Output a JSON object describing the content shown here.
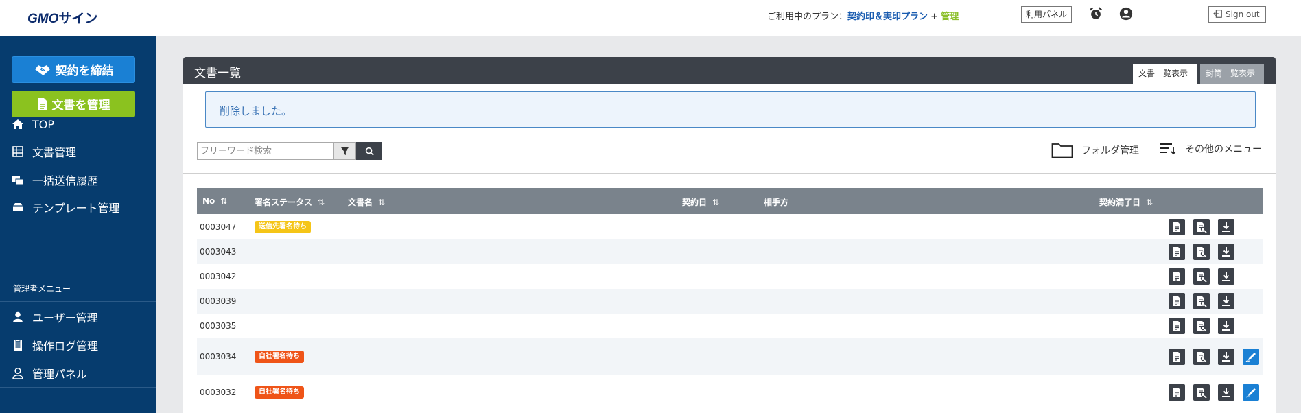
{
  "header": {
    "logo_gmo": "GMO",
    "logo_sign": "サイン",
    "plan_prefix": "ご利用中のプラン：",
    "plan_name": "契約印＆実印プラン",
    "plan_plus": " + ",
    "plan_admin": "管理",
    "panel_button": "利用パネル",
    "signout": "Sign out"
  },
  "sidebar": {
    "contract_button": "契約を締結",
    "docs_button": "文書を管理",
    "items": [
      {
        "label": "TOP",
        "icon": "home-icon"
      },
      {
        "label": "文書管理",
        "icon": "table-icon"
      },
      {
        "label": "一括送信履歴",
        "icon": "bulk-send-icon"
      },
      {
        "label": "テンプレート管理",
        "icon": "template-icon"
      }
    ],
    "admin_heading": "管理者メニュー",
    "admin_items": [
      {
        "label": "ユーザー管理",
        "icon": "user-icon"
      },
      {
        "label": "操作ログ管理",
        "icon": "log-icon"
      },
      {
        "label": "管理パネル",
        "icon": "admin-panel-icon"
      }
    ]
  },
  "main": {
    "title": "文書一覧",
    "tabs": [
      {
        "label": "文書一覧表示",
        "active": true
      },
      {
        "label": "封筒一覧表示",
        "active": false
      }
    ],
    "alert": "削除しました。",
    "search": {
      "placeholder": "フリーワード検索",
      "value": ""
    },
    "folder_label": "フォルダ管理",
    "other_menu_label": "その他のメニュー"
  },
  "table": {
    "columns": {
      "no": "No",
      "status": "署名ステータス",
      "name": "文書名",
      "date": "契約日",
      "partner": "相手方",
      "expire": "契約満了日",
      "sort": "⇅"
    },
    "rows": [
      {
        "no": "0003047",
        "status": "送信先署名待ち",
        "status_color": "yellow",
        "sign": false
      },
      {
        "no": "0003043",
        "status": "",
        "status_color": "",
        "sign": false
      },
      {
        "no": "0003042",
        "status": "",
        "status_color": "",
        "sign": false
      },
      {
        "no": "0003039",
        "status": "",
        "status_color": "",
        "sign": false
      },
      {
        "no": "0003035",
        "status": "",
        "status_color": "",
        "sign": false
      },
      {
        "no": "0003034",
        "status": "自社署名待ち",
        "status_color": "orange",
        "sign": true
      },
      {
        "no": "0003032",
        "status": "自社署名待ち",
        "status_color": "orange",
        "sign": true
      }
    ]
  },
  "colors": {
    "sidebar": "#063c6e",
    "contract_button": "#1a80d4",
    "docs_button": "#8bc21f",
    "panel_header": "#3c4149",
    "table_header": "#7a838c",
    "badge_yellow": "#f5c518",
    "badge_orange": "#ef5418"
  }
}
